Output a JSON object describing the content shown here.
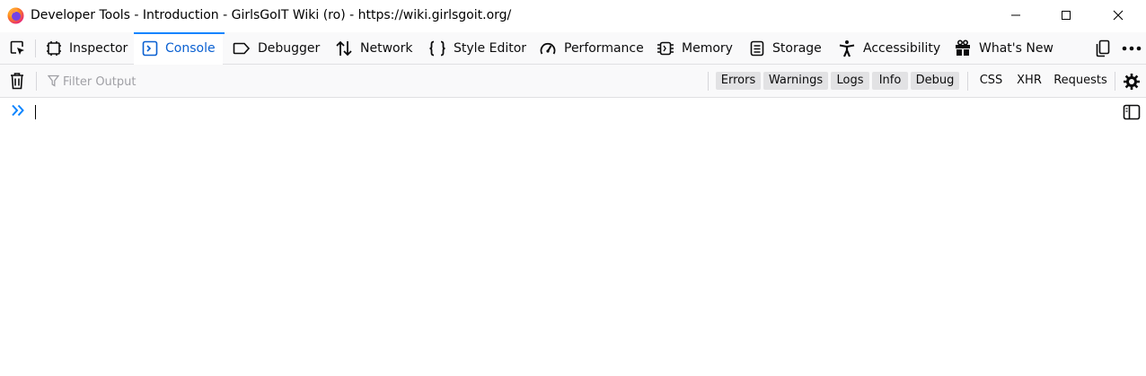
{
  "window": {
    "title": "Developer Tools - Introduction - GirlsGoIT Wiki (ro) - https://wiki.girlsgoit.org/"
  },
  "toolbox": {
    "tabs": [
      {
        "label": "Inspector",
        "icon": "inspector-icon"
      },
      {
        "label": "Console",
        "icon": "console-icon",
        "selected": true
      },
      {
        "label": "Debugger",
        "icon": "debugger-icon"
      },
      {
        "label": "Network",
        "icon": "network-icon"
      },
      {
        "label": "Style Editor",
        "icon": "style-editor-icon"
      },
      {
        "label": "Performance",
        "icon": "performance-icon"
      },
      {
        "label": "Memory",
        "icon": "memory-icon"
      },
      {
        "label": "Storage",
        "icon": "storage-icon"
      },
      {
        "label": "Accessibility",
        "icon": "accessibility-icon"
      },
      {
        "label": "What's New",
        "icon": "gift-icon"
      }
    ]
  },
  "console": {
    "filter_placeholder": "Filter Output",
    "levels": [
      "Errors",
      "Warnings",
      "Logs",
      "Info",
      "Debug"
    ],
    "extra_filters": [
      "CSS",
      "XHR",
      "Requests"
    ],
    "input_value": ""
  },
  "colors": {
    "accent": "#0a84ff",
    "selected_text": "#0a60d1",
    "toolbar_bg": "#f9f9fa",
    "level_button_bg": "#e2e2e4"
  }
}
